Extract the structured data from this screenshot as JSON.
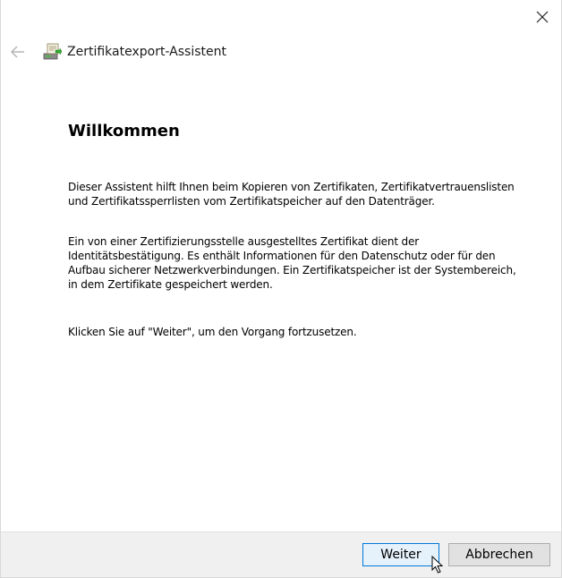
{
  "window": {
    "title": "Zertifikatexport-Assistent"
  },
  "content": {
    "heading": "Willkommen",
    "paragraph1": "Dieser Assistent hilft Ihnen beim Kopieren von Zertifikaten, Zertifikatvertrauenslisten und Zertifikatssperrlisten vom Zertifikatspeicher auf den Datenträger.",
    "paragraph2": "Ein von einer Zertifizierungsstelle ausgestelltes Zertifikat dient der Identitätsbestätigung. Es enthält Informationen für den Datenschutz oder für den Aufbau sicherer Netzwerkverbindungen. Ein Zertifikatspeicher ist der Systembereich, in dem Zertifikate gespeichert werden.",
    "paragraph3": "Klicken Sie auf \"Weiter\", um den Vorgang fortzusetzen."
  },
  "footer": {
    "next_label": "Weiter",
    "cancel_label": "Abbrechen"
  },
  "icons": {
    "close": "close-icon",
    "back": "back-arrow-icon",
    "wizard": "certificate-wizard-icon"
  },
  "colors": {
    "accent": "#0078d7",
    "footer_bg": "#f0f0f0"
  }
}
